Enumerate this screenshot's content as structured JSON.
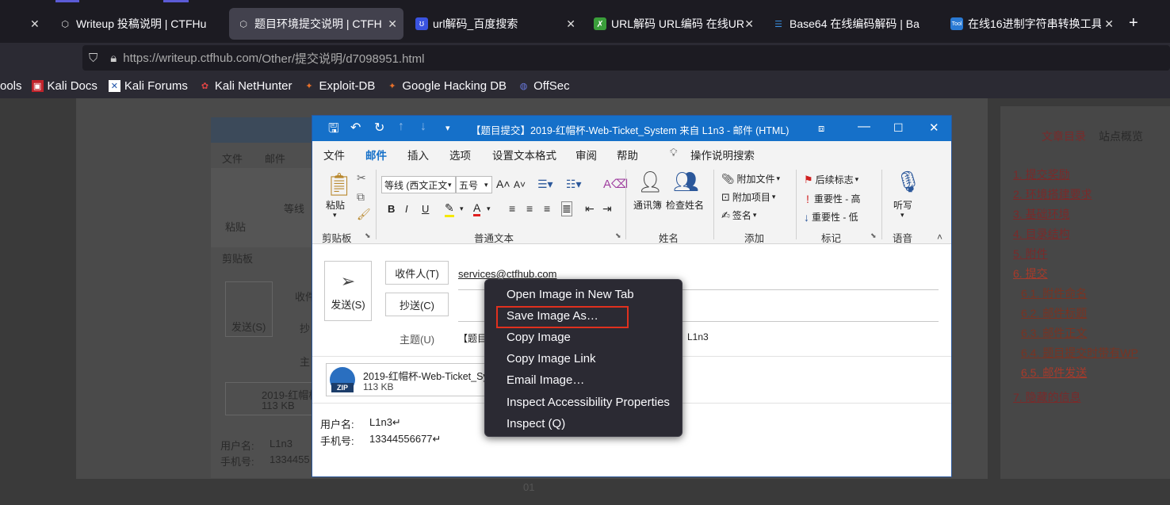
{
  "browser": {
    "tabs": [
      {
        "title": "Writeup 投稿说明 | CTFHu",
        "icon": "ctfhub-icon"
      },
      {
        "title": "题目环境提交说明 | CTFHu",
        "icon": "ctfhub-icon",
        "active": true
      },
      {
        "title": "url解码_百度搜索",
        "icon": "baidu-icon"
      },
      {
        "title": "URL解码 URL编码 在线UR",
        "icon": "tool-icon"
      },
      {
        "title": "Base64 在线编码解码 | Ba",
        "icon": "base64-icon"
      },
      {
        "title": "在线16进制字符串转换工具",
        "icon": "tool-icon"
      }
    ],
    "new_tab": "+",
    "url_host": "https://writeup.ctfhub.com",
    "url_path": "/Other/提交说明/d7098951.html",
    "bookmarks": [
      "ools",
      "Kali Docs",
      "Kali Forums",
      "Kali NetHunter",
      "Exploit-DB",
      "Google Hacking DB",
      "OffSec"
    ]
  },
  "toc": {
    "tabs": [
      "文章目录",
      "站点概览"
    ],
    "items": [
      "1. 提交奖励",
      "2. 环境搭建要求",
      "3. 基础环境",
      "4. 目录结构",
      "5. 附件",
      "6. 提交"
    ],
    "subitems": [
      "6.1. 附件命名",
      "6.2. 邮件标题",
      "6.3. 邮件正文",
      "6.4. 题目提交时带有WP",
      "6.5. 邮件发送"
    ],
    "last_item": "7. 隐藏的信息"
  },
  "bg_doc": {
    "tabs": [
      "文件",
      "邮件"
    ],
    "paste": "粘贴",
    "clipboard": "剪贴板",
    "send": "发送(S)",
    "to": "收件",
    "cc": "抄",
    "subject": "主",
    "attach_name": "2019-红帽杯",
    "attach_size": "113 KB",
    "user_label": "用户名:",
    "user_value": "L1n3",
    "phone_label": "手机号:",
    "phone_value": "1334455",
    "font": "等线",
    "page_num": "01"
  },
  "outlook": {
    "title": "【题目提交】2019-红帽杯-Web-Ticket_System 来自 L1n3  -  邮件 (HTML)",
    "tabs": [
      "文件",
      "邮件",
      "插入",
      "选项",
      "设置文本格式",
      "审阅",
      "帮助"
    ],
    "tell_me": "操作说明搜索",
    "ribbon": {
      "paste": "粘贴",
      "clipboard": "剪贴板",
      "font_name": "等线 (西文正文",
      "font_size": "五号",
      "basic_text": "普通文本",
      "address_book": "通讯簿",
      "check_names": "检查姓名",
      "names": "姓名",
      "attach_file": "附加文件",
      "attach_item": "附加项目",
      "signature": "签名",
      "include": "添加",
      "follow_up": "后续标志",
      "high_importance": "重要性 - 高",
      "low_importance": "重要性 - 低",
      "tags": "标记",
      "dictate": "听写",
      "voice": "语音"
    },
    "send": "发送(S)",
    "to_btn": "收件人(T)",
    "cc_btn": "抄送(C)",
    "subject_label": "主题(U)",
    "to_value": "services@ctfhub.com",
    "subject_value_start": "【题目",
    "subject_value_end": "L1n3",
    "attachment": {
      "name": "2019-红帽杯-Web-Ticket_Sy",
      "size": "113 KB",
      "ext": "ZIP"
    },
    "body": {
      "user_label": "用户名:",
      "user_value": "L1n3↵",
      "phone_label": "手机号:",
      "phone_value": "13344556677↵"
    }
  },
  "context_menu": {
    "items": [
      {
        "label": "Open Image in New Tab"
      },
      {
        "label": "Save Image As…",
        "highlighted": true
      },
      {
        "label": "Copy Image"
      },
      {
        "label": "Copy Image Link"
      },
      {
        "label": "Email Image…"
      },
      {
        "label": "Inspect Accessibility Properties"
      },
      {
        "label": "Inspect (Q)"
      }
    ]
  },
  "colors": {
    "accent": "#1570c9",
    "highlight_border": "#e0301e",
    "menu_bg": "#2b2a33"
  }
}
